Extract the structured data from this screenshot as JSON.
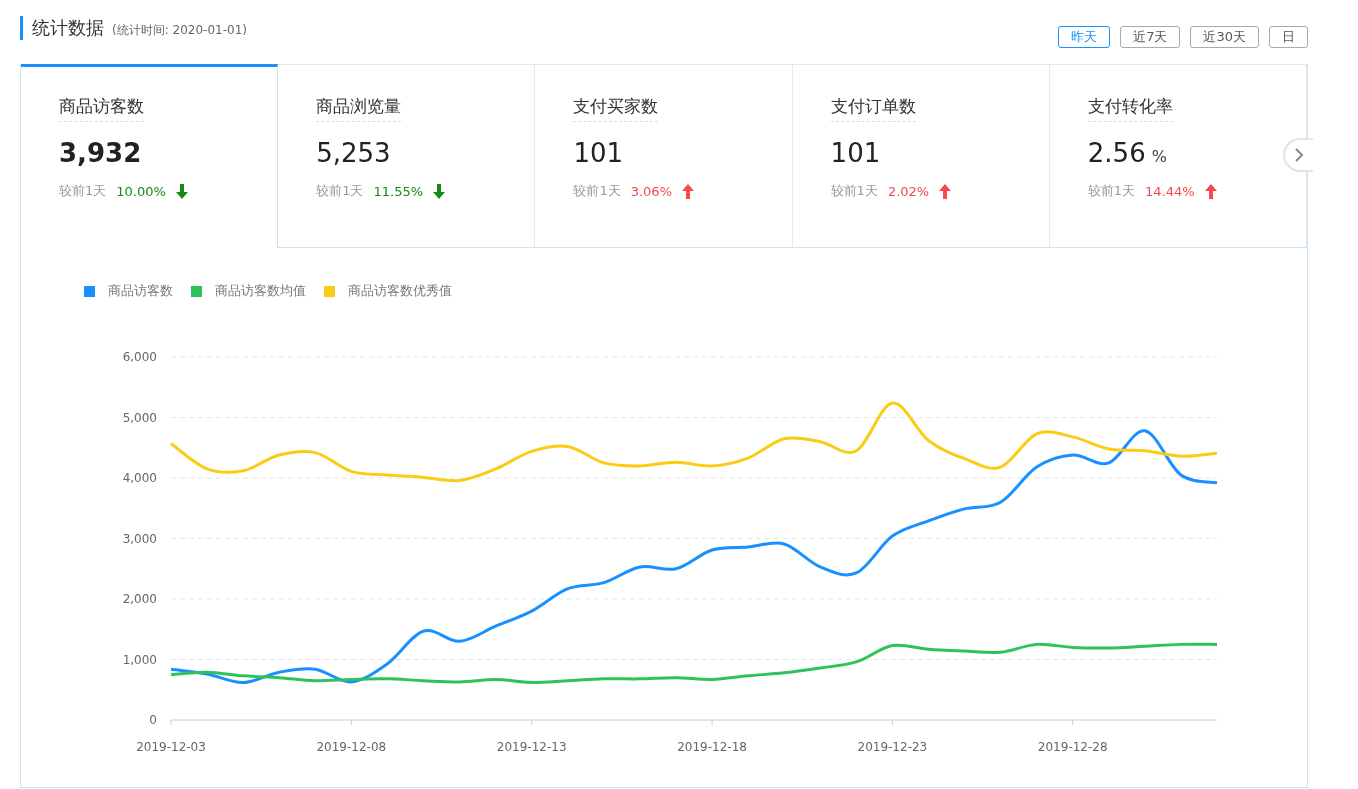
{
  "header": {
    "title": "统计数据",
    "subtitle": "(统计时间: 2020-01-01)"
  },
  "ranges": [
    {
      "label": "昨天",
      "selected": true
    },
    {
      "label": "近7天",
      "selected": false
    },
    {
      "label": "近30天",
      "selected": false
    },
    {
      "label": "日",
      "selected": false
    }
  ],
  "cards": [
    {
      "title": "商品访客数",
      "value": "3,932",
      "selected": true,
      "compare": "较前1天",
      "change": "10.00%",
      "kind": "down"
    },
    {
      "title": "商品浏览量",
      "value": "5,253",
      "selected": false,
      "compare": "较前1天",
      "change": "11.55%",
      "kind": "down"
    },
    {
      "title": "支付买家数",
      "value": "101",
      "selected": false,
      "compare": "较前1天",
      "change": "3.06%",
      "kind": "up"
    },
    {
      "title": "支付订单数",
      "value": "101",
      "selected": false,
      "compare": "较前1天",
      "change": "2.02%",
      "kind": "up"
    },
    {
      "title": "支付转化率",
      "value": "2.56",
      "unit": "%",
      "selected": false,
      "compare": "较前1天",
      "change": "14.44%",
      "kind": "up"
    }
  ],
  "chart_data": {
    "type": "line",
    "grid": true,
    "ylim": [
      0,
      6000
    ],
    "categories": [
      "2019-12-03",
      null,
      null,
      null,
      null,
      "2019-12-08",
      null,
      null,
      null,
      null,
      "2019-12-13",
      null,
      null,
      null,
      null,
      "2019-12-18",
      null,
      null,
      null,
      null,
      "2019-12-23",
      null,
      null,
      null,
      null,
      "2019-12-28",
      null,
      null,
      null,
      null
    ],
    "yticks": [
      {
        "value": 0,
        "label": "0"
      },
      {
        "value": 1000,
        "label": "1,000"
      },
      {
        "value": 2000,
        "label": "2,000"
      },
      {
        "value": 3000,
        "label": "3,000"
      },
      {
        "value": 4000,
        "label": "4,000"
      },
      {
        "value": 5000,
        "label": "5,000"
      },
      {
        "value": 6000,
        "label": "6,000"
      }
    ],
    "series": [
      {
        "name": "商品访客数",
        "color": "#1890ff",
        "values": [
          840,
          760,
          620,
          790,
          840,
          630,
          930,
          1470,
          1300,
          1550,
          1800,
          2170,
          2270,
          2530,
          2500,
          2810,
          2860,
          2910,
          2530,
          2430,
          3040,
          3290,
          3490,
          3600,
          4180,
          4380,
          4250,
          4780,
          4050,
          3920
        ]
      },
      {
        "name": "商品访客数均值",
        "color": "#2fc25b",
        "values": [
          750,
          790,
          730,
          700,
          650,
          670,
          680,
          650,
          630,
          670,
          620,
          650,
          680,
          680,
          700,
          670,
          730,
          780,
          860,
          960,
          1230,
          1170,
          1140,
          1120,
          1250,
          1200,
          1190,
          1220,
          1250,
          1250
        ]
      },
      {
        "name": "商品访客数优秀值",
        "color": "#facc14",
        "values": [
          4570,
          4150,
          4120,
          4380,
          4420,
          4110,
          4050,
          4010,
          3960,
          4150,
          4440,
          4520,
          4250,
          4200,
          4260,
          4200,
          4330,
          4650,
          4600,
          4450,
          5240,
          4620,
          4320,
          4180,
          4730,
          4680,
          4480,
          4450,
          4360,
          4410
        ]
      }
    ]
  }
}
